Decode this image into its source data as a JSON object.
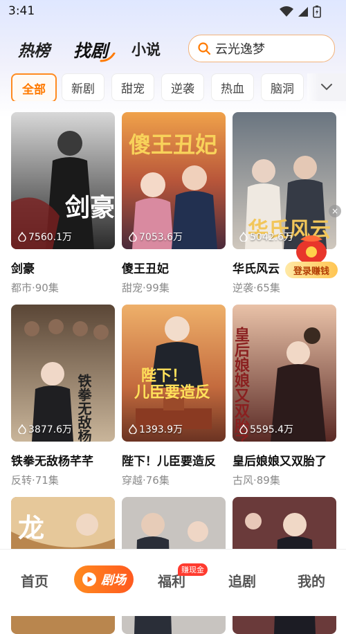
{
  "status_bar": {
    "time": "3:41"
  },
  "header": {
    "tabs": [
      {
        "label": "热榜",
        "active": false
      },
      {
        "label": "找剧",
        "active": true
      },
      {
        "label": "小说",
        "active": false
      }
    ],
    "search_placeholder": "云光逸梦"
  },
  "categories": {
    "items": [
      "全部",
      "新剧",
      "甜宠",
      "逆袭",
      "热血",
      "脑洞"
    ],
    "active_index": 0
  },
  "dramas": [
    {
      "title": "剑豪",
      "genre": "都市",
      "episodes": "90集",
      "meta": "都市·90集",
      "views": "7560.1万"
    },
    {
      "title": "傻王丑妃",
      "genre": "甜宠",
      "episodes": "99集",
      "meta": "甜宠·99集",
      "views": "7053.6万"
    },
    {
      "title": "华氏风云",
      "genre": "逆袭",
      "episodes": "65集",
      "meta": "逆袭·65集",
      "views": "5042.6万"
    },
    {
      "title": "铁拳无敌杨芊芊",
      "genre": "反转",
      "episodes": "71集",
      "meta": "反转·71集",
      "views": "3877.6万"
    },
    {
      "title": "陛下！儿臣要造反",
      "genre": "穿越",
      "episodes": "76集",
      "meta": "穿越·76集",
      "views": "1393.9万"
    },
    {
      "title": "皇后娘娘又双胎了",
      "genre": "古风",
      "episodes": "89集",
      "meta": "古风·89集",
      "views": "5595.4万"
    },
    {
      "title": "",
      "meta": "",
      "views": ""
    },
    {
      "title": "",
      "meta": "",
      "views": ""
    },
    {
      "title": "",
      "meta": "",
      "views": ""
    }
  ],
  "poster_text": {
    "p1": "剑豪",
    "p2": "傻王丑妃",
    "p3": "华氏风云",
    "p4": "铁拳无敌杨芊芊",
    "p5a": "陛下！",
    "p5b": "儿臣要造反",
    "p6": "皇后娘娘又双胎了",
    "p7": "龙"
  },
  "float_promo": {
    "label": "登录赚钱",
    "close": "×"
  },
  "bottom_nav": {
    "items": [
      {
        "label": "首页",
        "active": false
      },
      {
        "label": "剧场",
        "active": true
      },
      {
        "label": "福利",
        "active": false,
        "badge": "赚现金"
      },
      {
        "label": "追剧",
        "active": false
      },
      {
        "label": "我的",
        "active": false
      }
    ]
  },
  "colors": {
    "accent": "#ff7a00",
    "active_nav_start": "#ff8a1f",
    "active_nav_end": "#ff5a1f",
    "badge": "#ff3b2f",
    "meta_text": "#8a8a8a"
  }
}
